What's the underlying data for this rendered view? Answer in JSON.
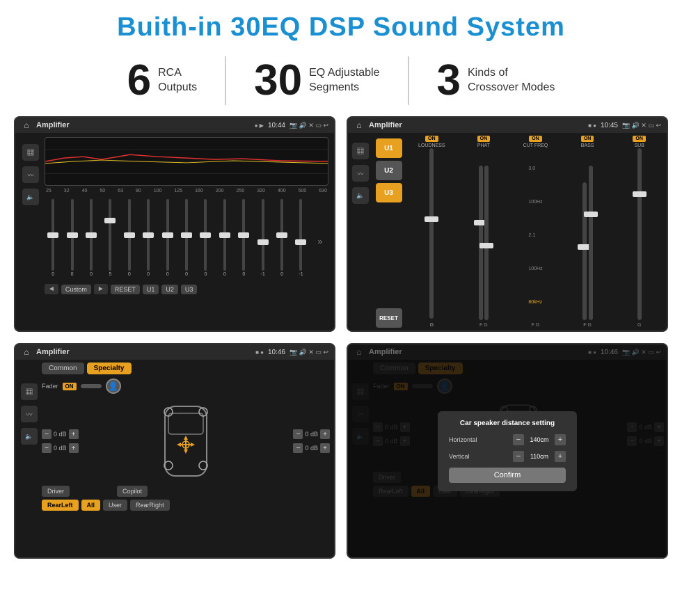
{
  "header": {
    "title": "Buith-in 30EQ DSP Sound System"
  },
  "stats": [
    {
      "number": "6",
      "label": "RCA\nOutputs"
    },
    {
      "number": "30",
      "label": "EQ Adjustable\nSegments"
    },
    {
      "number": "3",
      "label": "Kinds of\nCrossover Modes"
    }
  ],
  "screen1": {
    "statusBar": {
      "title": "Amplifier",
      "time": "10:44"
    },
    "freqLabels": [
      "25",
      "32",
      "40",
      "50",
      "63",
      "80",
      "100",
      "125",
      "160",
      "200",
      "250",
      "320",
      "400",
      "500",
      "630"
    ],
    "sliderValues": [
      "0",
      "0",
      "0",
      "5",
      "0",
      "0",
      "0",
      "0",
      "0",
      "0",
      "0",
      "-1",
      "0",
      "-1"
    ],
    "buttons": {
      "prev": "◄",
      "label": "Custom",
      "next": "►",
      "reset": "RESET",
      "u1": "U1",
      "u2": "U2",
      "u3": "U3",
      "more": "»"
    }
  },
  "screen2": {
    "statusBar": {
      "title": "Amplifier",
      "time": "10:45"
    },
    "uButtons": [
      "U1",
      "U2",
      "U3"
    ],
    "channels": [
      {
        "label": "LOUDNESS",
        "on": true
      },
      {
        "label": "PHAT",
        "on": true
      },
      {
        "label": "CUT FREQ",
        "on": true
      },
      {
        "label": "BASS",
        "on": true
      },
      {
        "label": "SUB",
        "on": true
      }
    ],
    "resetBtn": "RESET"
  },
  "screen3": {
    "statusBar": {
      "title": "Amplifier",
      "time": "10:46"
    },
    "tabs": [
      "Common",
      "Specialty"
    ],
    "activeTab": "Specialty",
    "faderLabel": "Fader",
    "faderOn": "ON",
    "dbValues": [
      "0 dB",
      "0 dB",
      "0 dB",
      "0 dB"
    ],
    "buttons": [
      "Driver",
      "Copilot",
      "RearLeft",
      "All",
      "User",
      "RearRight"
    ]
  },
  "screen4": {
    "statusBar": {
      "title": "Amplifier",
      "time": "10:46"
    },
    "tabs": [
      "Common",
      "Specialty"
    ],
    "activeTab": "Specialty",
    "faderOn": "ON",
    "dialog": {
      "title": "Car speaker distance setting",
      "horizontal": {
        "label": "Horizontal",
        "value": "140cm"
      },
      "vertical": {
        "label": "Vertical",
        "value": "110cm"
      },
      "confirmBtn": "Confirm"
    },
    "dbValues": [
      "0 dB",
      "0 dB"
    ],
    "buttons": [
      "Driver",
      "Copilot",
      "RearLeft",
      "All",
      "User",
      "RearRight"
    ]
  }
}
